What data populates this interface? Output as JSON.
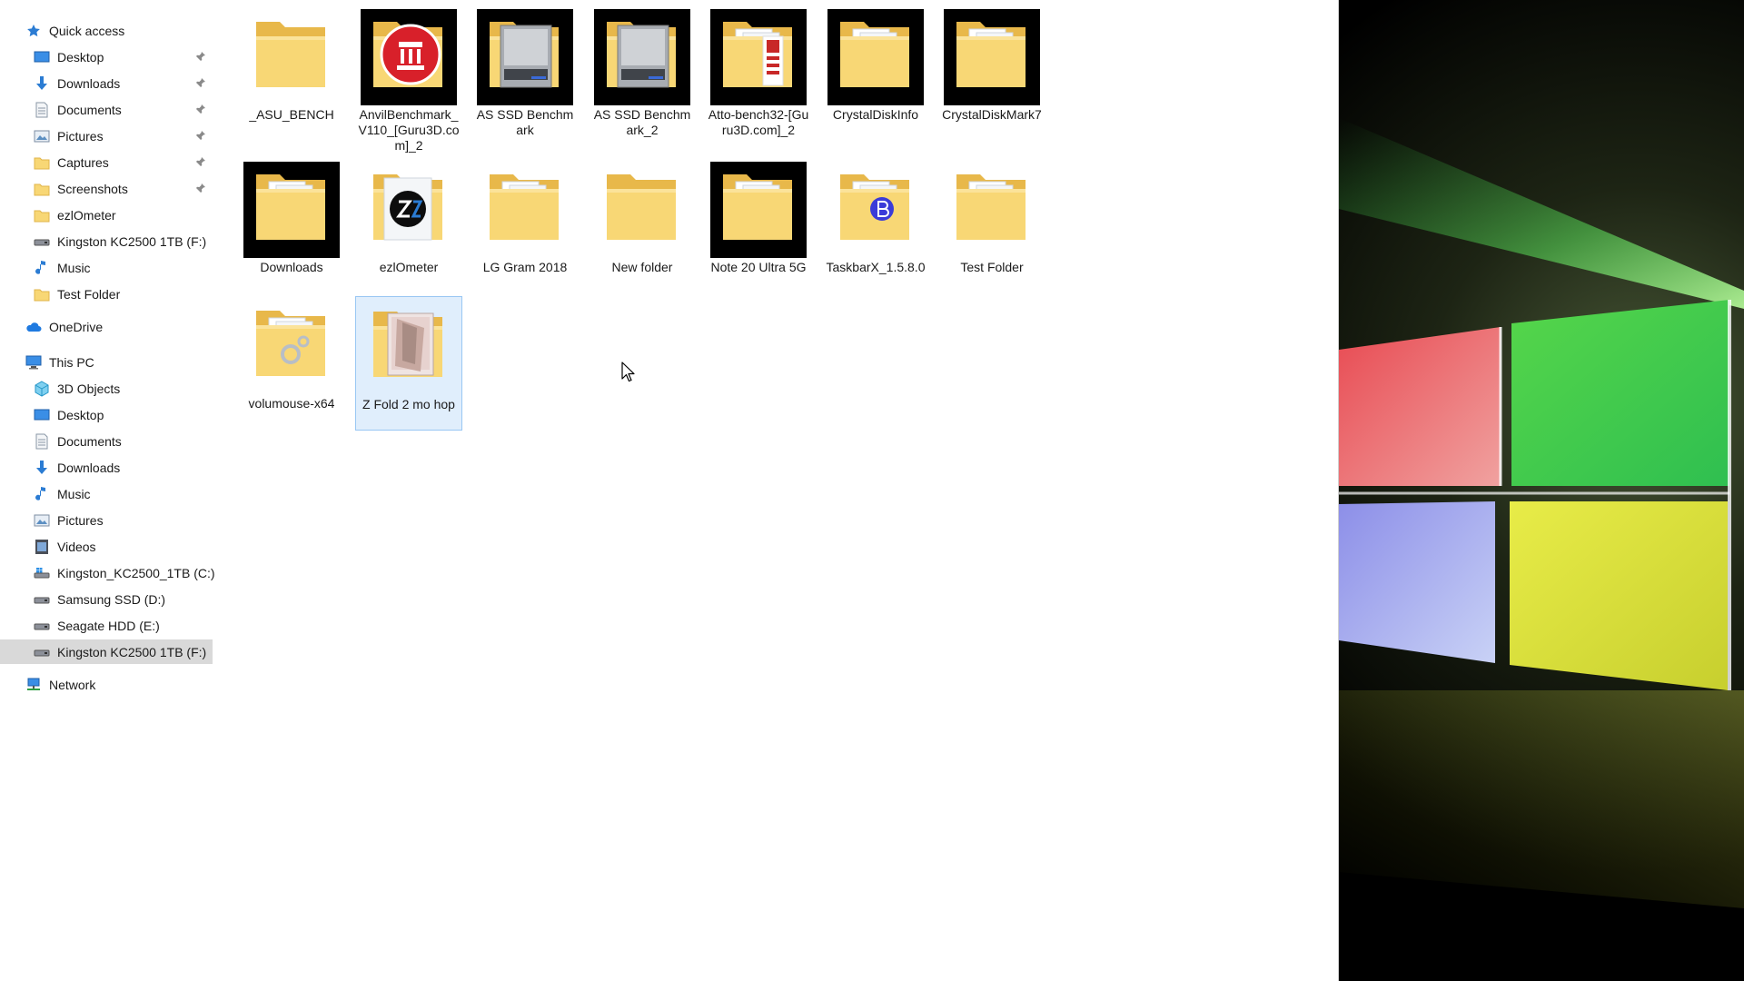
{
  "nav": {
    "quick_access": "Quick access",
    "items": [
      {
        "label": "Desktop",
        "icon": "desktop-icon",
        "pinned": true
      },
      {
        "label": "Downloads",
        "icon": "downloads-icon",
        "pinned": true
      },
      {
        "label": "Documents",
        "icon": "documents-icon",
        "pinned": true
      },
      {
        "label": "Pictures",
        "icon": "pictures-icon",
        "pinned": true
      },
      {
        "label": "Captures",
        "icon": "folder-icon",
        "pinned": true
      },
      {
        "label": "Screenshots",
        "icon": "folder-icon",
        "pinned": true
      },
      {
        "label": "ezlOmeter",
        "icon": "folder-icon",
        "pinned": false
      },
      {
        "label": "Kingston KC2500 1TB (F:)",
        "icon": "drive-icon",
        "pinned": false
      },
      {
        "label": "Music",
        "icon": "music-icon",
        "pinned": false
      },
      {
        "label": "Test Folder",
        "icon": "folder-icon",
        "pinned": false
      }
    ],
    "onedrive": "OneDrive",
    "this_pc": "This PC",
    "pc_items": [
      {
        "label": "3D Objects",
        "icon": "3d-objects-icon"
      },
      {
        "label": "Desktop",
        "icon": "desktop-icon"
      },
      {
        "label": "Documents",
        "icon": "documents-icon"
      },
      {
        "label": "Downloads",
        "icon": "downloads-icon"
      },
      {
        "label": "Music",
        "icon": "music-icon"
      },
      {
        "label": "Pictures",
        "icon": "pictures-icon"
      },
      {
        "label": "Videos",
        "icon": "videos-icon"
      },
      {
        "label": "Kingston_KC2500_1TB (C:)",
        "icon": "windows-drive-icon"
      },
      {
        "label": "Samsung SSD (D:)",
        "icon": "drive-icon"
      },
      {
        "label": "Seagate HDD (E:)",
        "icon": "drive-icon"
      },
      {
        "label": "Kingston KC2500 1TB (F:)",
        "icon": "drive-icon"
      }
    ],
    "network": "Network"
  },
  "folders": [
    {
      "label": "_ASU_BENCH",
      "thumb": "plain-folder"
    },
    {
      "label": "AnvilBenchmark_V110_[Guru3D.com]_2",
      "thumb": "anvil-folder"
    },
    {
      "label": "AS SSD Benchmark",
      "thumb": "asssd-folder"
    },
    {
      "label": "AS SSD Benchmark_2",
      "thumb": "asssd-folder"
    },
    {
      "label": "Atto-bench32-[Guru3D.com]_2",
      "thumb": "atto-folder"
    },
    {
      "label": "CrystalDiskInfo",
      "thumb": "docs-folder"
    },
    {
      "label": "CrystalDiskMark7",
      "thumb": "docs-folder"
    },
    {
      "label": "Downloads",
      "thumb": "docs-folder"
    },
    {
      "label": "ezlOmeter",
      "thumb": "ez-folder"
    },
    {
      "label": "LG Gram 2018",
      "thumb": "docs-folder"
    },
    {
      "label": "New folder",
      "thumb": "plain-folder"
    },
    {
      "label": "Note 20 Ultra 5G",
      "thumb": "docs-folder"
    },
    {
      "label": "TaskbarX_1.5.8.0",
      "thumb": "taskbarx-folder"
    },
    {
      "label": "Test Folder",
      "thumb": "docs-folder"
    },
    {
      "label": "volumouse-x64",
      "thumb": "gear-folder"
    },
    {
      "label": "Z Fold 2 mo hop",
      "thumb": "image-folder"
    }
  ],
  "colors": {
    "folder": "#f8d775",
    "folder_dark": "#e8b84a",
    "selection_bg": "#e0eefc",
    "selection_border": "#99c7f3",
    "nav_selected": "#d9d9d9"
  }
}
